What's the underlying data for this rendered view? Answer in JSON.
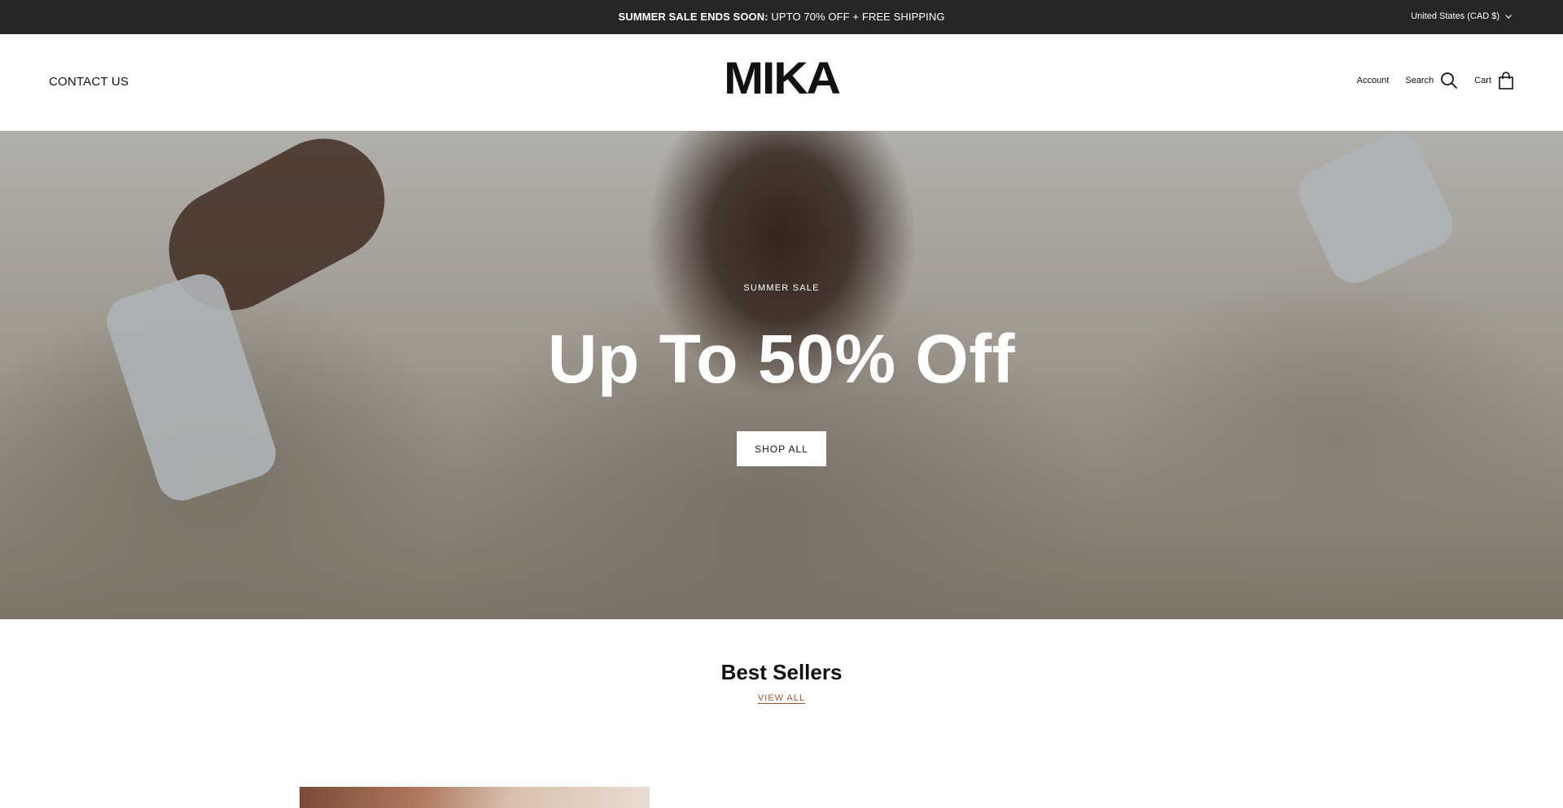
{
  "announcement": {
    "bold": "SUMMER SALE ENDS SOON:",
    "text": "UPTO 70% OFF + FREE SHIPPING",
    "country": "United States (CAD $)"
  },
  "header": {
    "contact": "CONTACT US",
    "logo": "MIKA",
    "account": "Account",
    "search": "Search",
    "cart": "Cart"
  },
  "hero": {
    "eyebrow": "SUMMER SALE",
    "headline": "Up To 50% Off",
    "button": "SHOP ALL"
  },
  "best_sellers": {
    "title": "Best Sellers",
    "view_all": "VIEW ALL"
  },
  "colors": {
    "announcement_bg": "#262626",
    "link_accent": "#a0522d"
  },
  "icons": [
    "chevron-down-icon",
    "search-icon",
    "bag-icon"
  ]
}
